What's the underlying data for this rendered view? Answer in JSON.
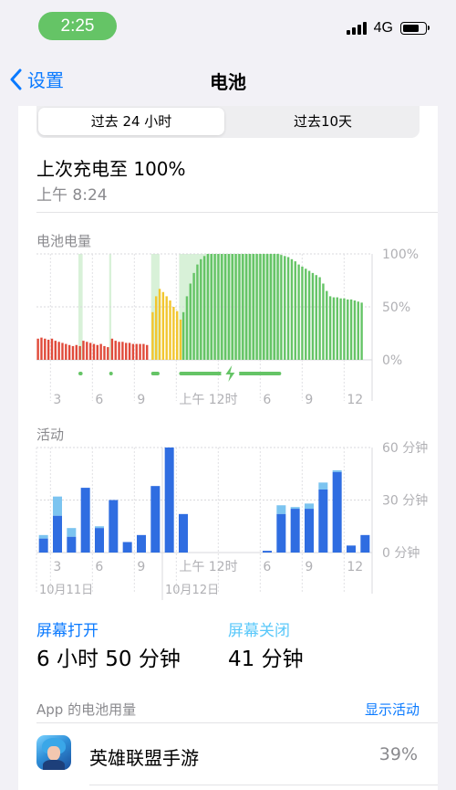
{
  "status_bar": {
    "time": "2:25",
    "network": "4G",
    "battery_level": 0.75
  },
  "nav": {
    "back_label": "设置",
    "title": "电池"
  },
  "segments": [
    "过去 24 小时",
    "过去10天"
  ],
  "last_charge": {
    "label": "上次充电至 100%",
    "time": "上午 8:24"
  },
  "battery_chart": {
    "title": "电池电量",
    "y_ticks": [
      "100%",
      "50%",
      "0%"
    ],
    "x_ticks": [
      "3",
      "6",
      "9",
      "上午 12时",
      "6",
      "9",
      "12"
    ]
  },
  "activity_chart": {
    "title": "活动",
    "y_ticks": [
      "60 分钟",
      "30 分钟",
      "0 分钟"
    ],
    "x_ticks": [
      "3",
      "6",
      "9",
      "上午 12时",
      "6",
      "9",
      "12"
    ],
    "dates": [
      "10月11日",
      "10月12日"
    ]
  },
  "screen_time": {
    "on_label": "屏幕打开",
    "on_value": "6 小时 50 分钟",
    "off_label": "屏幕关闭",
    "off_value": "41 分钟"
  },
  "app_usage": {
    "label": "App 的电池用量",
    "show_activity": "显示活动",
    "apps": [
      {
        "name": "英雄联盟手游",
        "percent": "39%"
      }
    ]
  },
  "colors": {
    "accent": "#0a7aff",
    "green": "#65c466",
    "yellow": "#f2c62f",
    "red": "#e04a3a",
    "screen_on": "#2f6de1",
    "screen_off": "#7cc4f0"
  },
  "chart_data": [
    {
      "type": "bar",
      "title": "电池电量",
      "ylim": [
        0,
        100
      ],
      "y_unit": "%",
      "x_range_hours": [
        0,
        24
      ],
      "charging_intervals": [
        [
          3.0,
          3.3
        ],
        [
          5.2,
          5.35
        ],
        [
          8.2,
          8.8
        ],
        [
          10.2,
          17.5
        ]
      ],
      "values": [
        {
          "x": 0.1,
          "y": 20,
          "state": "low"
        },
        {
          "x": 0.35,
          "y": 21,
          "state": "low"
        },
        {
          "x": 0.6,
          "y": 20,
          "state": "low"
        },
        {
          "x": 0.85,
          "y": 19,
          "state": "low"
        },
        {
          "x": 1.1,
          "y": 20,
          "state": "low"
        },
        {
          "x": 1.35,
          "y": 18,
          "state": "low"
        },
        {
          "x": 1.6,
          "y": 17,
          "state": "low"
        },
        {
          "x": 1.85,
          "y": 16,
          "state": "low"
        },
        {
          "x": 2.1,
          "y": 15,
          "state": "low"
        },
        {
          "x": 2.35,
          "y": 14,
          "state": "low"
        },
        {
          "x": 2.6,
          "y": 13,
          "state": "low"
        },
        {
          "x": 2.85,
          "y": 14,
          "state": "low"
        },
        {
          "x": 3.1,
          "y": 13,
          "state": "low"
        },
        {
          "x": 3.35,
          "y": 18,
          "state": "low"
        },
        {
          "x": 3.6,
          "y": 17,
          "state": "low"
        },
        {
          "x": 3.85,
          "y": 16,
          "state": "low"
        },
        {
          "x": 4.1,
          "y": 15,
          "state": "low"
        },
        {
          "x": 4.35,
          "y": 14,
          "state": "low"
        },
        {
          "x": 4.6,
          "y": 15,
          "state": "low"
        },
        {
          "x": 4.85,
          "y": 13,
          "state": "low"
        },
        {
          "x": 5.1,
          "y": 12,
          "state": "low"
        },
        {
          "x": 5.4,
          "y": 20,
          "state": "low"
        },
        {
          "x": 5.65,
          "y": 18,
          "state": "low"
        },
        {
          "x": 5.9,
          "y": 17,
          "state": "low"
        },
        {
          "x": 6.15,
          "y": 17,
          "state": "low"
        },
        {
          "x": 6.4,
          "y": 16,
          "state": "low"
        },
        {
          "x": 6.65,
          "y": 16,
          "state": "low"
        },
        {
          "x": 6.9,
          "y": 15,
          "state": "low"
        },
        {
          "x": 7.15,
          "y": 15,
          "state": "low"
        },
        {
          "x": 7.4,
          "y": 15,
          "state": "low"
        },
        {
          "x": 7.65,
          "y": 15,
          "state": "low"
        },
        {
          "x": 7.9,
          "y": 14,
          "state": "low"
        },
        {
          "x": 8.3,
          "y": 45,
          "state": "mid"
        },
        {
          "x": 8.55,
          "y": 60,
          "state": "mid"
        },
        {
          "x": 8.8,
          "y": 67,
          "state": "mid"
        },
        {
          "x": 9.05,
          "y": 64,
          "state": "mid"
        },
        {
          "x": 9.3,
          "y": 60,
          "state": "mid"
        },
        {
          "x": 9.55,
          "y": 56,
          "state": "mid"
        },
        {
          "x": 9.8,
          "y": 50,
          "state": "mid"
        },
        {
          "x": 10.05,
          "y": 46,
          "state": "mid"
        },
        {
          "x": 10.3,
          "y": 38,
          "state": "mid"
        },
        {
          "x": 10.5,
          "y": 45,
          "state": "ok"
        },
        {
          "x": 10.75,
          "y": 60,
          "state": "ok"
        },
        {
          "x": 11.0,
          "y": 72,
          "state": "ok"
        },
        {
          "x": 11.25,
          "y": 82,
          "state": "ok"
        },
        {
          "x": 11.5,
          "y": 90,
          "state": "ok"
        },
        {
          "x": 11.75,
          "y": 95,
          "state": "ok"
        },
        {
          "x": 12.0,
          "y": 98,
          "state": "ok"
        },
        {
          "x": 12.25,
          "y": 100,
          "state": "ok"
        },
        {
          "x": 12.5,
          "y": 100,
          "state": "ok"
        },
        {
          "x": 12.75,
          "y": 100,
          "state": "ok"
        },
        {
          "x": 13.0,
          "y": 100,
          "state": "ok"
        },
        {
          "x": 13.25,
          "y": 100,
          "state": "ok"
        },
        {
          "x": 13.5,
          "y": 100,
          "state": "ok"
        },
        {
          "x": 13.75,
          "y": 100,
          "state": "ok"
        },
        {
          "x": 14.0,
          "y": 100,
          "state": "ok"
        },
        {
          "x": 14.25,
          "y": 100,
          "state": "ok"
        },
        {
          "x": 14.5,
          "y": 100,
          "state": "ok"
        },
        {
          "x": 14.75,
          "y": 100,
          "state": "ok"
        },
        {
          "x": 15.0,
          "y": 100,
          "state": "ok"
        },
        {
          "x": 15.25,
          "y": 100,
          "state": "ok"
        },
        {
          "x": 15.5,
          "y": 100,
          "state": "ok"
        },
        {
          "x": 15.75,
          "y": 100,
          "state": "ok"
        },
        {
          "x": 16.0,
          "y": 100,
          "state": "ok"
        },
        {
          "x": 16.25,
          "y": 100,
          "state": "ok"
        },
        {
          "x": 16.5,
          "y": 100,
          "state": "ok"
        },
        {
          "x": 16.75,
          "y": 100,
          "state": "ok"
        },
        {
          "x": 17.0,
          "y": 100,
          "state": "ok"
        },
        {
          "x": 17.25,
          "y": 100,
          "state": "ok"
        },
        {
          "x": 17.5,
          "y": 99,
          "state": "ok"
        },
        {
          "x": 17.75,
          "y": 98,
          "state": "ok"
        },
        {
          "x": 18.0,
          "y": 97,
          "state": "ok"
        },
        {
          "x": 18.25,
          "y": 95,
          "state": "ok"
        },
        {
          "x": 18.5,
          "y": 93,
          "state": "ok"
        },
        {
          "x": 18.75,
          "y": 90,
          "state": "ok"
        },
        {
          "x": 19.0,
          "y": 88,
          "state": "ok"
        },
        {
          "x": 19.25,
          "y": 86,
          "state": "ok"
        },
        {
          "x": 19.5,
          "y": 84,
          "state": "ok"
        },
        {
          "x": 19.75,
          "y": 82,
          "state": "ok"
        },
        {
          "x": 20.0,
          "y": 80,
          "state": "ok"
        },
        {
          "x": 20.25,
          "y": 78,
          "state": "ok"
        },
        {
          "x": 20.5,
          "y": 72,
          "state": "ok"
        },
        {
          "x": 20.75,
          "y": 65,
          "state": "ok"
        },
        {
          "x": 21.0,
          "y": 60,
          "state": "ok"
        },
        {
          "x": 21.25,
          "y": 59,
          "state": "ok"
        },
        {
          "x": 21.5,
          "y": 59,
          "state": "ok"
        },
        {
          "x": 21.75,
          "y": 58,
          "state": "ok"
        },
        {
          "x": 22.0,
          "y": 58,
          "state": "ok"
        },
        {
          "x": 22.25,
          "y": 57,
          "state": "ok"
        },
        {
          "x": 22.5,
          "y": 57,
          "state": "ok"
        },
        {
          "x": 22.75,
          "y": 56,
          "state": "ok"
        },
        {
          "x": 23.0,
          "y": 55,
          "state": "ok"
        },
        {
          "x": 23.25,
          "y": 54,
          "state": "ok"
        }
      ]
    },
    {
      "type": "bar",
      "title": "活动",
      "ylim": [
        0,
        60
      ],
      "y_unit": "分钟",
      "x_range_hours": [
        0,
        24
      ],
      "series": [
        {
          "name": "屏幕打开",
          "values": [
            {
              "x": 0.5,
              "y": 8
            },
            {
              "x": 1.5,
              "y": 21
            },
            {
              "x": 2.5,
              "y": 9
            },
            {
              "x": 3.5,
              "y": 37
            },
            {
              "x": 4.5,
              "y": 14
            },
            {
              "x": 5.5,
              "y": 30
            },
            {
              "x": 6.5,
              "y": 6
            },
            {
              "x": 7.5,
              "y": 10
            },
            {
              "x": 8.5,
              "y": 38
            },
            {
              "x": 9.5,
              "y": 60
            },
            {
              "x": 10.5,
              "y": 22
            },
            {
              "x": 16.5,
              "y": 1
            },
            {
              "x": 17.5,
              "y": 22
            },
            {
              "x": 18.5,
              "y": 25
            },
            {
              "x": 19.5,
              "y": 25
            },
            {
              "x": 20.5,
              "y": 36
            },
            {
              "x": 21.5,
              "y": 46
            },
            {
              "x": 22.5,
              "y": 4
            },
            {
              "x": 23.5,
              "y": 10
            }
          ]
        },
        {
          "name": "屏幕关闭",
          "values": [
            {
              "x": 0.5,
              "y": 2
            },
            {
              "x": 1.5,
              "y": 11
            },
            {
              "x": 2.5,
              "y": 5
            },
            {
              "x": 3.5,
              "y": 0
            },
            {
              "x": 4.5,
              "y": 1
            },
            {
              "x": 5.5,
              "y": 0
            },
            {
              "x": 6.5,
              "y": 0
            },
            {
              "x": 7.5,
              "y": 0
            },
            {
              "x": 8.5,
              "y": 0
            },
            {
              "x": 9.5,
              "y": 0
            },
            {
              "x": 10.5,
              "y": 0
            },
            {
              "x": 16.5,
              "y": 0
            },
            {
              "x": 17.5,
              "y": 5
            },
            {
              "x": 18.5,
              "y": 1
            },
            {
              "x": 19.5,
              "y": 3
            },
            {
              "x": 20.5,
              "y": 4
            },
            {
              "x": 21.5,
              "y": 1
            },
            {
              "x": 22.5,
              "y": 0
            },
            {
              "x": 23.5,
              "y": 0
            }
          ]
        }
      ]
    }
  ]
}
